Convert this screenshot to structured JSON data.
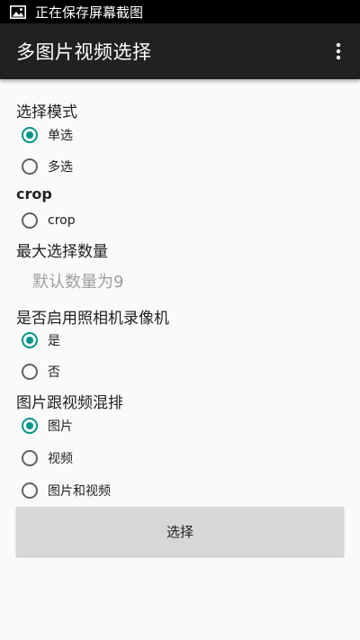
{
  "status_bar": {
    "icon": "image-icon",
    "text": "正在保存屏幕截图"
  },
  "app_bar": {
    "title": "多图片视频选择",
    "menu_icon": "more-vert-icon"
  },
  "sections": {
    "mode": {
      "title": "选择模式",
      "options": [
        {
          "label": "单选",
          "checked": true
        },
        {
          "label": "多选",
          "checked": false
        }
      ]
    },
    "crop": {
      "title": "crop",
      "options": [
        {
          "label": "crop",
          "checked": false
        }
      ]
    },
    "max_count": {
      "title": "最大选择数量",
      "placeholder": "默认数量为9"
    },
    "camera": {
      "title": "是否启用照相机录像机",
      "options": [
        {
          "label": "是",
          "checked": true
        },
        {
          "label": "否",
          "checked": false
        }
      ]
    },
    "mix": {
      "title": "图片跟视频混排",
      "options": [
        {
          "label": "图片",
          "checked": true
        },
        {
          "label": "视频",
          "checked": false
        },
        {
          "label": "图片和视频",
          "checked": false
        }
      ]
    }
  },
  "select_button": "选择",
  "colors": {
    "accent": "#009688",
    "app_bar": "#212121",
    "button": "#d6d7d7"
  }
}
